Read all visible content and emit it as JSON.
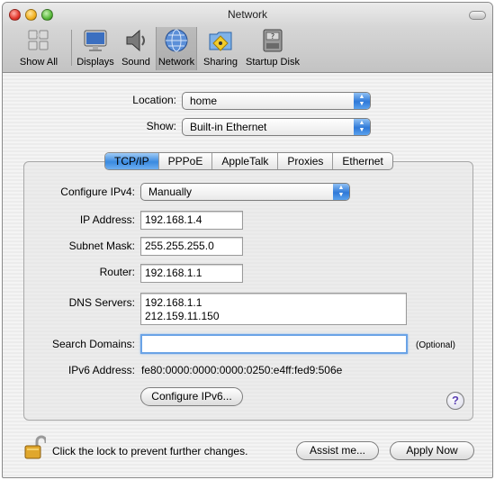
{
  "window": {
    "title": "Network"
  },
  "toolbar": {
    "items": [
      {
        "label": "Show All",
        "icon": "show-all-icon"
      },
      {
        "label": "Displays",
        "icon": "display-icon"
      },
      {
        "label": "Sound",
        "icon": "speaker-icon"
      },
      {
        "label": "Network",
        "icon": "globe-icon",
        "selected": true
      },
      {
        "label": "Sharing",
        "icon": "sharing-folder-icon"
      },
      {
        "label": "Startup Disk",
        "icon": "disk-icon"
      }
    ]
  },
  "location": {
    "label": "Location:",
    "value": "home"
  },
  "show": {
    "label": "Show:",
    "value": "Built-in Ethernet"
  },
  "tabs": [
    {
      "label": "TCP/IP",
      "selected": true
    },
    {
      "label": "PPPoE"
    },
    {
      "label": "AppleTalk"
    },
    {
      "label": "Proxies"
    },
    {
      "label": "Ethernet"
    }
  ],
  "form": {
    "configure_ipv4": {
      "label": "Configure IPv4:",
      "value": "Manually"
    },
    "ip_address": {
      "label": "IP Address:",
      "value": "192.168.1.4"
    },
    "subnet_mask": {
      "label": "Subnet Mask:",
      "value": "255.255.255.0"
    },
    "router": {
      "label": "Router:",
      "value": "192.168.1.1"
    },
    "dns_servers": {
      "label": "DNS Servers:",
      "values": [
        "192.168.1.1",
        "212.159.11.150"
      ]
    },
    "search_domains": {
      "label": "Search Domains:",
      "value": "",
      "hint": "(Optional)"
    },
    "ipv6_address": {
      "label": "IPv6 Address:",
      "value": "fe80:0000:0000:0000:0250:e4ff:fed9:506e"
    },
    "configure_ipv6_button": "Configure IPv6..."
  },
  "help_button": "?",
  "footer": {
    "lock_text": "Click the lock to prevent further changes.",
    "assist_button": "Assist me...",
    "apply_button": "Apply Now"
  },
  "colors": {
    "accent": "#3a8ae0",
    "focus_ring": "#6aa3e6",
    "help_glyph": "#5b3fb3"
  }
}
